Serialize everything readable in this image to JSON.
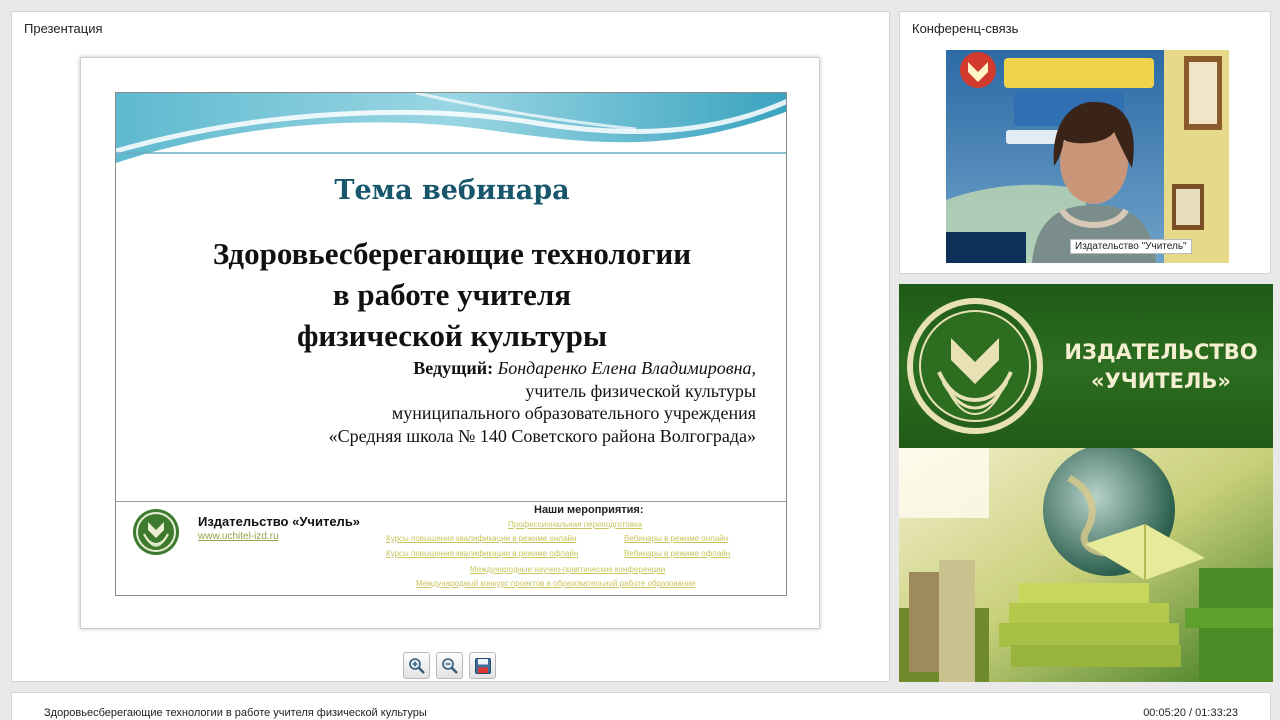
{
  "presentation_panel": {
    "title": "Презентация"
  },
  "slide": {
    "topic": "Тема вебинара",
    "heading_lines": [
      "Здоровьесберегающие технологии",
      "в работе учителя",
      "физической культуры"
    ],
    "presenter_label": "Ведущий:",
    "presenter_name": "Бондаренко Елена Владимировна,",
    "presenter_lines": [
      "учитель физической культуры",
      "муниципального образовательного учреждения",
      "«Средняя школа № 140 Советского района Волгограда»"
    ],
    "publisher_name": "Издательство «Учитель»",
    "publisher_site": "www.uchitel-izd.ru",
    "events_heading": "Наши мероприятия:",
    "events": [
      "Профессиональная переподготовка",
      "Курсы повышения квалификации в режиме онлайн",
      "Вебинары в режиме онлайн",
      "Курсы повышения квалификации в режиме офлайн",
      "Вебинары в режиме офлайн",
      "Международные научно-практические конференции",
      "Международный конкурс проектов в образовательной работе образования"
    ]
  },
  "toolbar": {
    "zoom_in_icon": "zoom-in-icon",
    "zoom_out_icon": "zoom-out-icon",
    "save_icon": "floppy-disk-icon"
  },
  "conference_panel": {
    "title": "Конференц-связь",
    "video_badge": "Издательство \"Учитель\""
  },
  "publisher_banner": {
    "name_line1": "ИЗДАТЕЛЬСТВО",
    "name_line2": "«УЧИТЕЛЬ»"
  },
  "footer": {
    "webinar_title": "Здоровьесберегающие технологии в работе учителя физической культуры",
    "time": "00:05:20 / 01:33:23"
  },
  "colors": {
    "slide_topic": "#17566b",
    "banner_green": "#2c6d20",
    "banner_text": "#f4efd1",
    "event_link": "#c9c45c"
  }
}
